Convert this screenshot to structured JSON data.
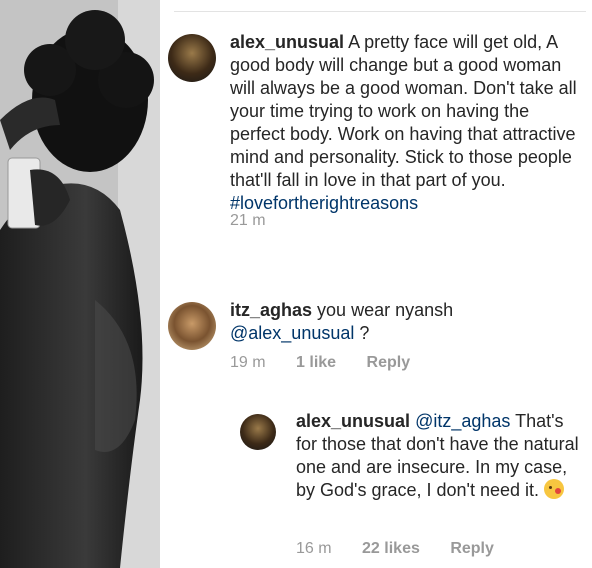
{
  "comments": [
    {
      "username": "alex_unusual",
      "text": "A pretty face will get old, A good body will change but a good woman will always be a good woman. Don't take all your time trying to work on having the perfect body. Work on having that attractive mind and personality. Stick to those people that'll fall in love in that part of you.",
      "hashtag": "#lovefortherightreasons",
      "time": "21 m"
    },
    {
      "username": "itz_aghas",
      "text": "you wear nyansh",
      "mention": "@alex_unusual",
      "text_after": " ?",
      "time": "19 m",
      "likes": "1 like",
      "reply": "Reply"
    },
    {
      "username": "alex_unusual",
      "mention": "@itz_aghas",
      "text": "That's for those that don't have the natural one and are insecure. In my case, by God's grace, I don't need it.",
      "emoji_icon": "kissing-face-emoji-icon",
      "time": "16 m",
      "likes": "22 likes",
      "reply": "Reply"
    }
  ]
}
